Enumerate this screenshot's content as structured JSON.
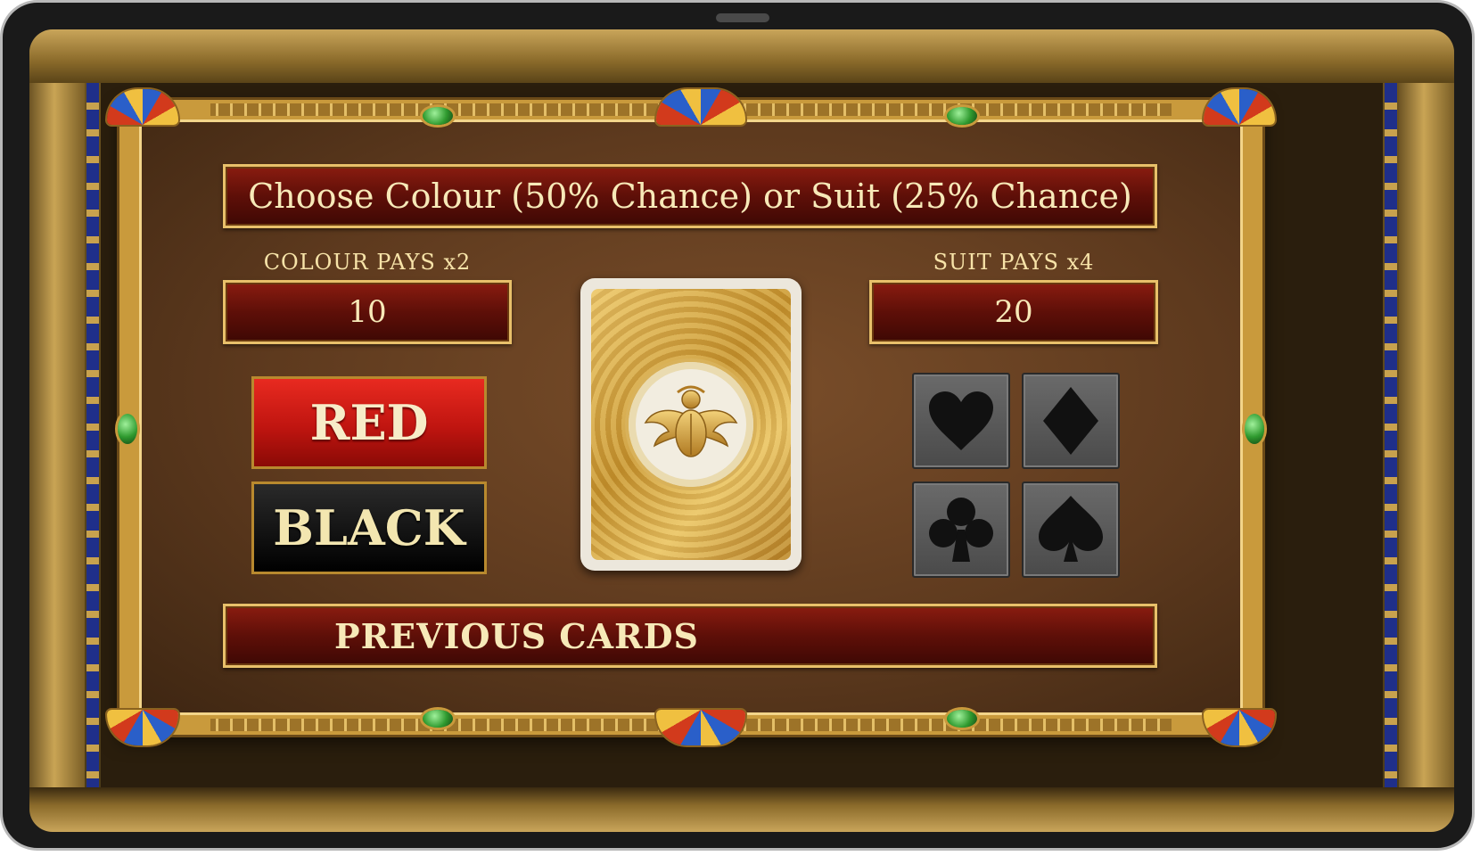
{
  "header": {
    "title": "Choose Colour (50% Chance) or Suit (25% Chance)"
  },
  "colour": {
    "label": "COLOUR PAYS x2",
    "value": "10",
    "red_label": "RED",
    "black_label": "BLACK"
  },
  "suit": {
    "label": "SUIT PAYS x4",
    "value": "20",
    "options": [
      "heart-icon",
      "diamond-icon",
      "club-icon",
      "spade-icon"
    ]
  },
  "card": {
    "emblem": "scarab-icon"
  },
  "previous": {
    "label": "PREVIOUS CARDS"
  },
  "colors": {
    "banner": "#5e0f08",
    "gold_text": "#f7e9b8",
    "red_button": "#c01510",
    "black_button": "#111111",
    "suit_tile": "#4a4a4a"
  }
}
